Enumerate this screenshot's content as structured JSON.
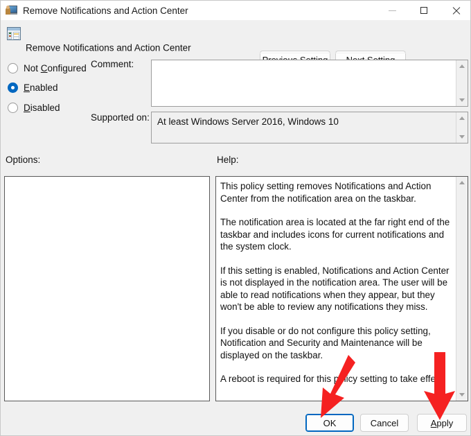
{
  "window": {
    "title": "Remove Notifications and Action Center",
    "icon": "policy-computer-icon",
    "controls": {
      "minimize": "minimize-icon",
      "maximize": "maximize-icon",
      "close": "close-icon"
    }
  },
  "header": {
    "icon": "policy-setting-icon",
    "title": "Remove Notifications and Action Center",
    "previous_setting": "Previous Setting",
    "previous_setting_accel": "P",
    "next_setting": "Next Setting",
    "next_setting_accel": "N"
  },
  "state": {
    "options": [
      {
        "label": "Not Configured",
        "accel": "C",
        "selected": false
      },
      {
        "label": "Enabled",
        "accel": "E",
        "selected": true
      },
      {
        "label": "Disabled",
        "accel": "D",
        "selected": false
      }
    ],
    "selected_value": "Enabled",
    "accent_color": "#0067c0"
  },
  "comment": {
    "label": "Comment:",
    "value": "",
    "placeholder": ""
  },
  "supported_on": {
    "label": "Supported on:",
    "value": "At least Windows Server 2016, Windows 10"
  },
  "panels": {
    "options_label": "Options:",
    "options_content": "",
    "help_label": "Help:",
    "help_paragraphs": [
      "This policy setting removes Notifications and Action Center from the notification area on the taskbar.",
      "The notification area is located at the far right end of the taskbar and includes icons for current notifications and the system clock.",
      "If this setting is enabled, Notifications and Action Center is not displayed in the notification area. The user will be able to read notifications when they appear, but they won't be able to review any notifications they miss.",
      "If you disable or do not configure this policy setting, Notification and Security and Maintenance will be displayed on the taskbar.",
      "A reboot is required for this policy setting to take effect."
    ]
  },
  "footer": {
    "ok": "OK",
    "cancel": "Cancel",
    "apply": "Apply",
    "apply_accel": "A",
    "default_button": "OK"
  },
  "annotations": {
    "color": "#f52121",
    "arrows": [
      {
        "name": "arrow-pointing-to-ok",
        "target": "OK"
      },
      {
        "name": "arrow-pointing-to-apply",
        "target": "Apply"
      }
    ]
  }
}
